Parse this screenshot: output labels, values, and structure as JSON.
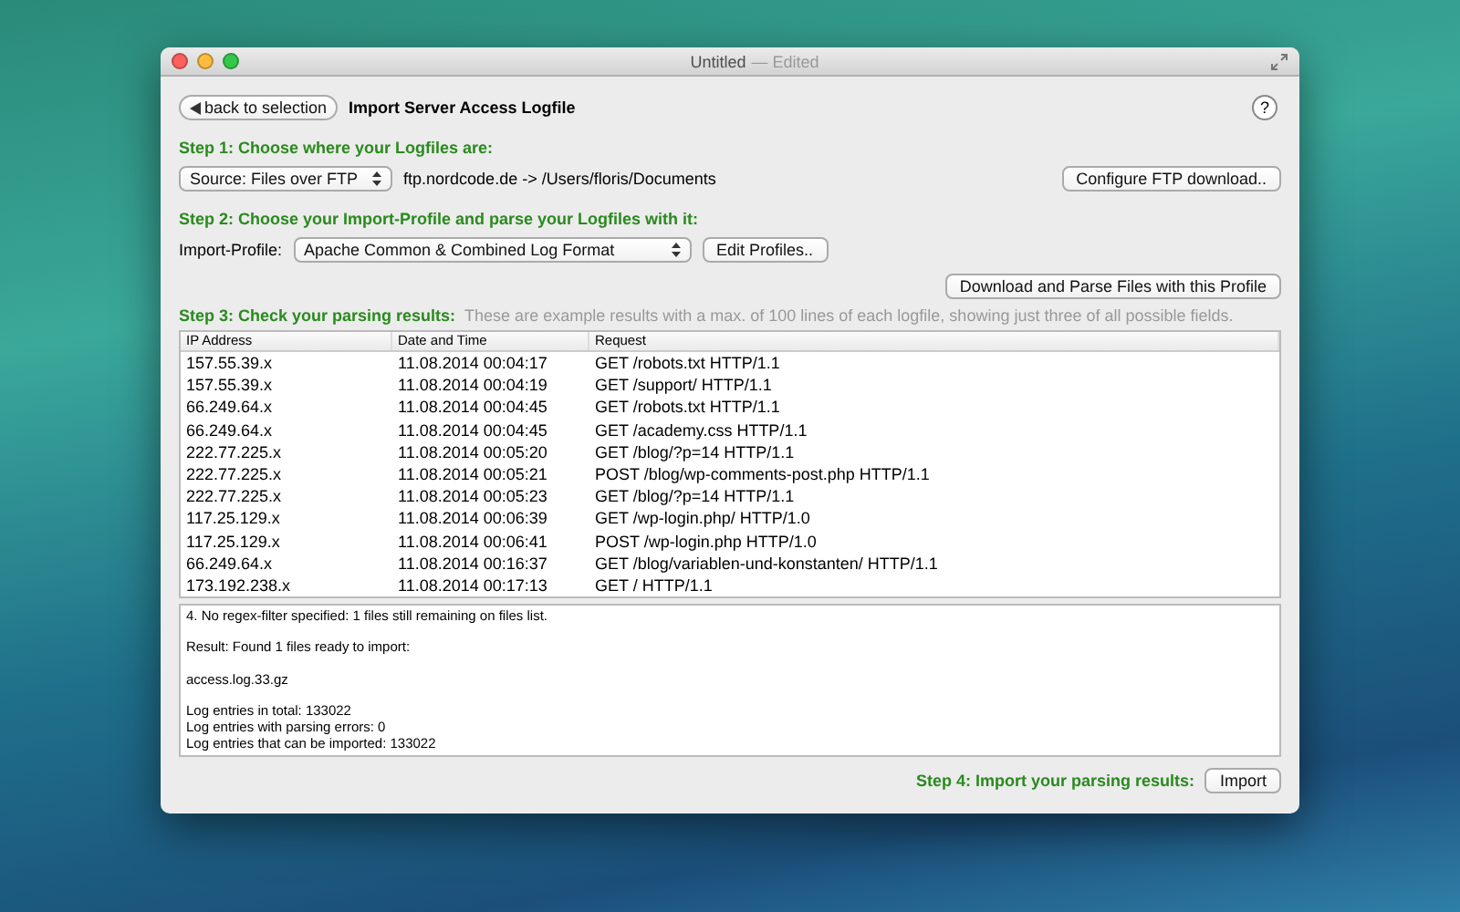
{
  "window": {
    "title": "Untitled",
    "subtitle": "— Edited"
  },
  "header": {
    "back_button": "back to selection",
    "title": "Import Server Access Logfile",
    "help": "?"
  },
  "step1": {
    "heading": "Step 1: Choose where your Logfiles are:",
    "source": "Source: Files over FTP",
    "path": "ftp.nordcode.de -> /Users/floris/Documents",
    "configure_button": "Configure FTP download.."
  },
  "step2": {
    "heading": "Step 2: Choose your Import-Profile and parse your Logfiles with it:",
    "profile_label": "Import-Profile:",
    "profile": "Apache Common & Combined Log Format",
    "edit_button": "Edit Profiles..",
    "parse_button": "Download and Parse Files with this Profile"
  },
  "step3": {
    "heading": "Step 3: Check your parsing results:",
    "note": "These are example results with a max. of 100 lines of each logfile, showing just three of all possible fields."
  },
  "table": {
    "columns": [
      "IP Address",
      "Date and Time",
      "Request"
    ],
    "rows": [
      [
        "157.55.39.x",
        "11.08.2014 00:04:17",
        "GET /robots.txt HTTP/1.1"
      ],
      [
        "157.55.39.x",
        "11.08.2014 00:04:19",
        "GET /support/ HTTP/1.1"
      ],
      [
        "66.249.64.x",
        "11.08.2014 00:04:45",
        "GET /robots.txt HTTP/1.1"
      ],
      [
        "66.249.64.x",
        "11.08.2014 00:04:45",
        "GET /academy.css HTTP/1.1"
      ],
      [
        "222.77.225.x",
        "11.08.2014 00:05:20",
        "GET /blog/?p=14 HTTP/1.1"
      ],
      [
        "222.77.225.x",
        "11.08.2014 00:05:21",
        "POST /blog/wp-comments-post.php HTTP/1.1"
      ],
      [
        "222.77.225.x",
        "11.08.2014 00:05:23",
        "GET /blog/?p=14 HTTP/1.1"
      ],
      [
        "117.25.129.x",
        "11.08.2014 00:06:39",
        "GET /wp-login.php/ HTTP/1.0"
      ],
      [
        "117.25.129.x",
        "11.08.2014 00:06:41",
        "POST /wp-login.php HTTP/1.0"
      ],
      [
        "66.249.64.x",
        "11.08.2014 00:16:37",
        "GET /blog/variablen-und-konstanten/ HTTP/1.1"
      ],
      [
        "173.192.238.x",
        "11.08.2014 00:17:13",
        "GET / HTTP/1.1"
      ]
    ]
  },
  "log": [
    [
      "4. No regex-filter specified: 1 files still remaining on files list."
    ],
    [
      "Result: Found 1 files ready to import:"
    ],
    [
      "access.log.33.gz"
    ],
    [
      "Log entries in total: 133022",
      "Log entries with parsing errors: 0",
      "Log entries that can be imported: 133022"
    ]
  ],
  "step4": {
    "heading": "Step 4: Import your parsing results:",
    "import_button": "Import"
  }
}
